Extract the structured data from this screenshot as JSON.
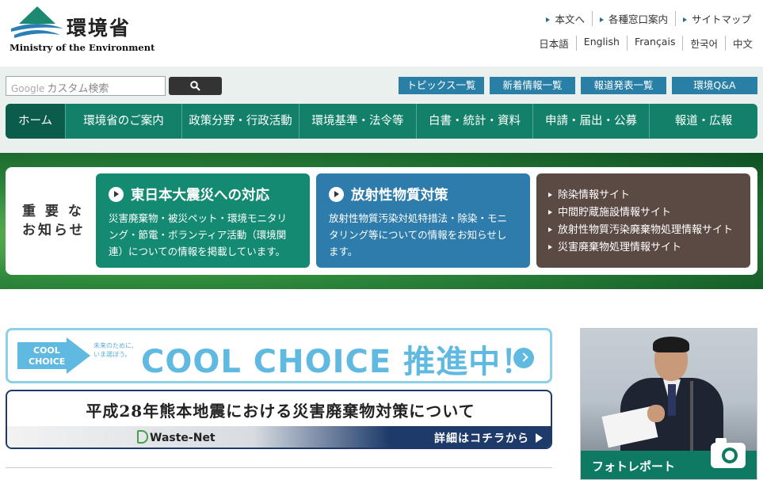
{
  "header": {
    "logo_jp": "環境省",
    "logo_en": "Ministry of the Environment",
    "links": [
      "本文へ",
      "各種窓口案内",
      "サイトマップ"
    ],
    "languages": [
      "日本語",
      "English",
      "Français",
      "한국어",
      "中文"
    ]
  },
  "search": {
    "google_label": "Google",
    "placeholder": "カスタム検索"
  },
  "quick_links": [
    "トピックス一覧",
    "新着情報一覧",
    "報道発表一覧",
    "環境Q&A"
  ],
  "nav": [
    "ホーム",
    "環境省のご案内",
    "政策分野・行政活動",
    "環境基準・法令等",
    "白書・統計・資料",
    "申請・届出・公募",
    "報道・広報"
  ],
  "notice": {
    "label_line1": "重 要 な",
    "label_line2": "お知らせ",
    "cards": [
      {
        "title": "東日本大震災への対応",
        "desc": "災害廃棄物・被災ペット・環境モニタリング・節電・ボランティア活動（環境関連）についての情報を掲載しています。",
        "color": "#148a72"
      },
      {
        "title": "放射性物質対策",
        "desc": "放射性物質汚染対処特措法・除染・モニタリング等についての情報をお知らせします。",
        "color": "#2e7cac"
      }
    ],
    "site_links": [
      "除染情報サイト",
      "中間貯蔵施設情報サイト",
      "放射性物質汚染廃棄物処理情報サイト",
      "災害廃棄物処理情報サイト"
    ],
    "site_links_color": "#5b4a44"
  },
  "cool_choice": {
    "arrow_line1": "COOL",
    "arrow_line2": "CHOICE",
    "small_text": "未来のために、いま選ぼう。",
    "headline": "COOL CHOICE 推進中！"
  },
  "quake_banner": {
    "title": "平成28年熊本地震における災害廃棄物対策について",
    "brand": "Waste-Net",
    "detail": "詳細はコチラから"
  },
  "photo_report": {
    "label": "フォトレポート"
  }
}
